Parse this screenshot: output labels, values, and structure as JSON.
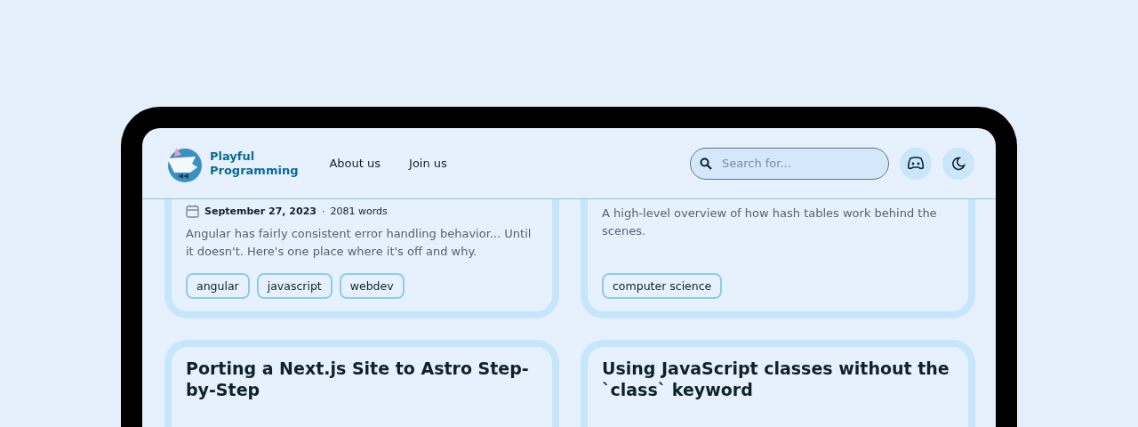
{
  "header": {
    "logo_text": [
      "Playful",
      "Programming"
    ],
    "nav": [
      {
        "label": "About us"
      },
      {
        "label": "Join us"
      }
    ],
    "search": {
      "placeholder": "Search for..."
    }
  },
  "cards": [
    {
      "date": "September 27, 2023",
      "separator": "·",
      "words": "2081 words",
      "description": "Angular has fairly consistent error handling behavior... Until it doesn't. Here's one place where it's off and why.",
      "tags": [
        "angular",
        "javascript",
        "webdev"
      ]
    },
    {
      "description": "A high-level overview of how hash tables work behind the scenes.",
      "tags": [
        "computer science"
      ]
    },
    {
      "title": "Porting a Next.js Site to Astro Step-by-Step"
    },
    {
      "title": "Using JavaScript classes without the `class` keyword"
    }
  ]
}
